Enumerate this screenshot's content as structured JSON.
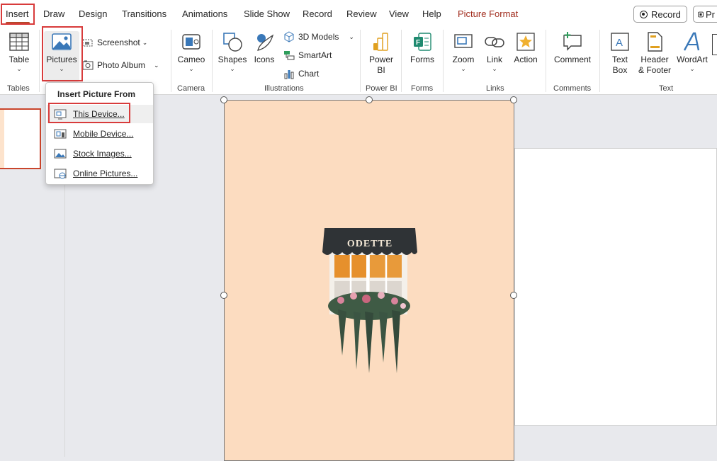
{
  "menu_tabs": {
    "insert": "Insert",
    "draw": "Draw",
    "design": "Design",
    "transitions": "Transitions",
    "animations": "Animations",
    "slide_show": "Slide Show",
    "record": "Record",
    "review": "Review",
    "view": "View",
    "help": "Help",
    "picture_format": "Picture Format"
  },
  "top_buttons": {
    "record": "Record",
    "present": "Pr"
  },
  "ribbon": {
    "table": "Table",
    "pictures": "Pictures",
    "screenshot": "Screenshot",
    "photo_album": "Photo Album",
    "cameo": "Cameo",
    "shapes": "Shapes",
    "icons": "Icons",
    "models_3d": "3D Models",
    "smartart": "SmartArt",
    "chart": "Chart",
    "power_bi": "Power BI",
    "forms": "Forms",
    "zoom": "Zoom",
    "link": "Link",
    "action": "Action",
    "comment": "Comment",
    "text_box": "Text Box",
    "header_footer": "Header & Footer",
    "wordart": "WordArt",
    "groups": {
      "tables": "Tables",
      "camera": "Camera",
      "illustrations": "Illustrations",
      "power_bi": "Power BI",
      "forms": "Forms",
      "links": "Links",
      "comments": "Comments",
      "text": "Text"
    }
  },
  "dropdown": {
    "title": "Insert Picture From",
    "items": [
      "This Device...",
      "Mobile Device...",
      "Stock Images...",
      "Online Pictures..."
    ]
  },
  "picture": {
    "shop_sign": "ODETTE"
  },
  "colors": {
    "accent": "#b7472a",
    "highlight_box": "#d83b3b",
    "picture_bg": "#fcdcc0"
  }
}
